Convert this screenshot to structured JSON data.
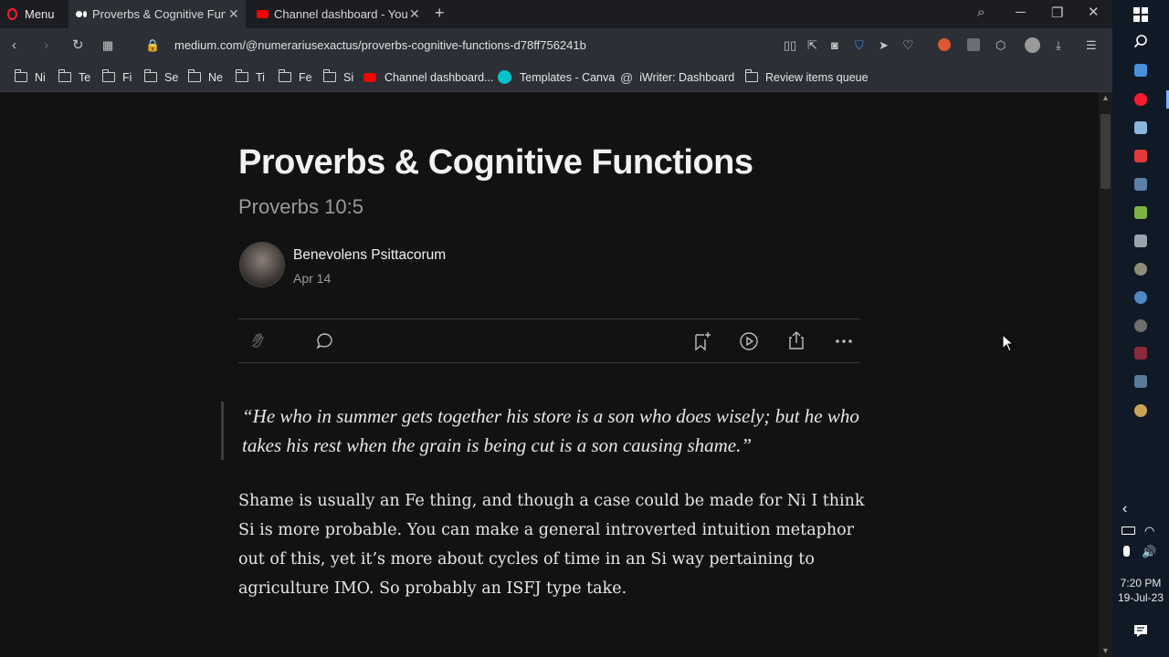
{
  "browser": {
    "menu_label": "Menu",
    "tabs": [
      {
        "title": "Proverbs & Cognitive Funct",
        "active": true
      },
      {
        "title": "Channel dashboard - YouTu",
        "active": false
      }
    ],
    "new_tab_icon": "plus-icon",
    "url": "medium.com/@numerariusexactus/proverbs-cognitive-functions-d78ff756241b",
    "bookmarks": [
      {
        "label": "Ni",
        "icon": "folder-icon"
      },
      {
        "label": "Te",
        "icon": "folder-icon"
      },
      {
        "label": "Fi",
        "icon": "folder-icon"
      },
      {
        "label": "Se",
        "icon": "folder-icon"
      },
      {
        "label": "Ne",
        "icon": "folder-icon"
      },
      {
        "label": "Ti",
        "icon": "folder-icon"
      },
      {
        "label": "Fe",
        "icon": "folder-icon"
      },
      {
        "label": "Si",
        "icon": "folder-icon"
      },
      {
        "label": "Channel dashboard...",
        "icon": "youtube-icon"
      },
      {
        "label": "Templates - Canva",
        "icon": "canva-icon"
      },
      {
        "label": "iWriter: Dashboard",
        "icon": "at-icon"
      },
      {
        "label": "Review items queue",
        "icon": "folder-icon"
      }
    ],
    "colors": {
      "opera_red": "#ff1b2d",
      "youtube_red": "#ff0000",
      "canva_blue": "#00c4cc",
      "vpn_blue": "#2e8cf0"
    }
  },
  "article": {
    "title": "Proverbs & Cognitive Functions",
    "subtitle": "Proverbs 10:5",
    "author": "Benevolens Psittacorum",
    "date": "Apr 14",
    "quote": "“He who in summer gets together his store is a son who does wisely; but he who takes his rest when the grain is being cut is a son causing shame.”",
    "paragraph": "Shame is usually an Fe thing, and though a case could be made for Ni I think Si is more probable. You can make a general introverted intuition metaphor out of this, yet it’s more about cycles of time in an Si way pertaining to agriculture IMO. So probably an ISFJ type take."
  },
  "taskbar": {
    "time": "7:20 PM",
    "date": "19-Jul-23"
  }
}
